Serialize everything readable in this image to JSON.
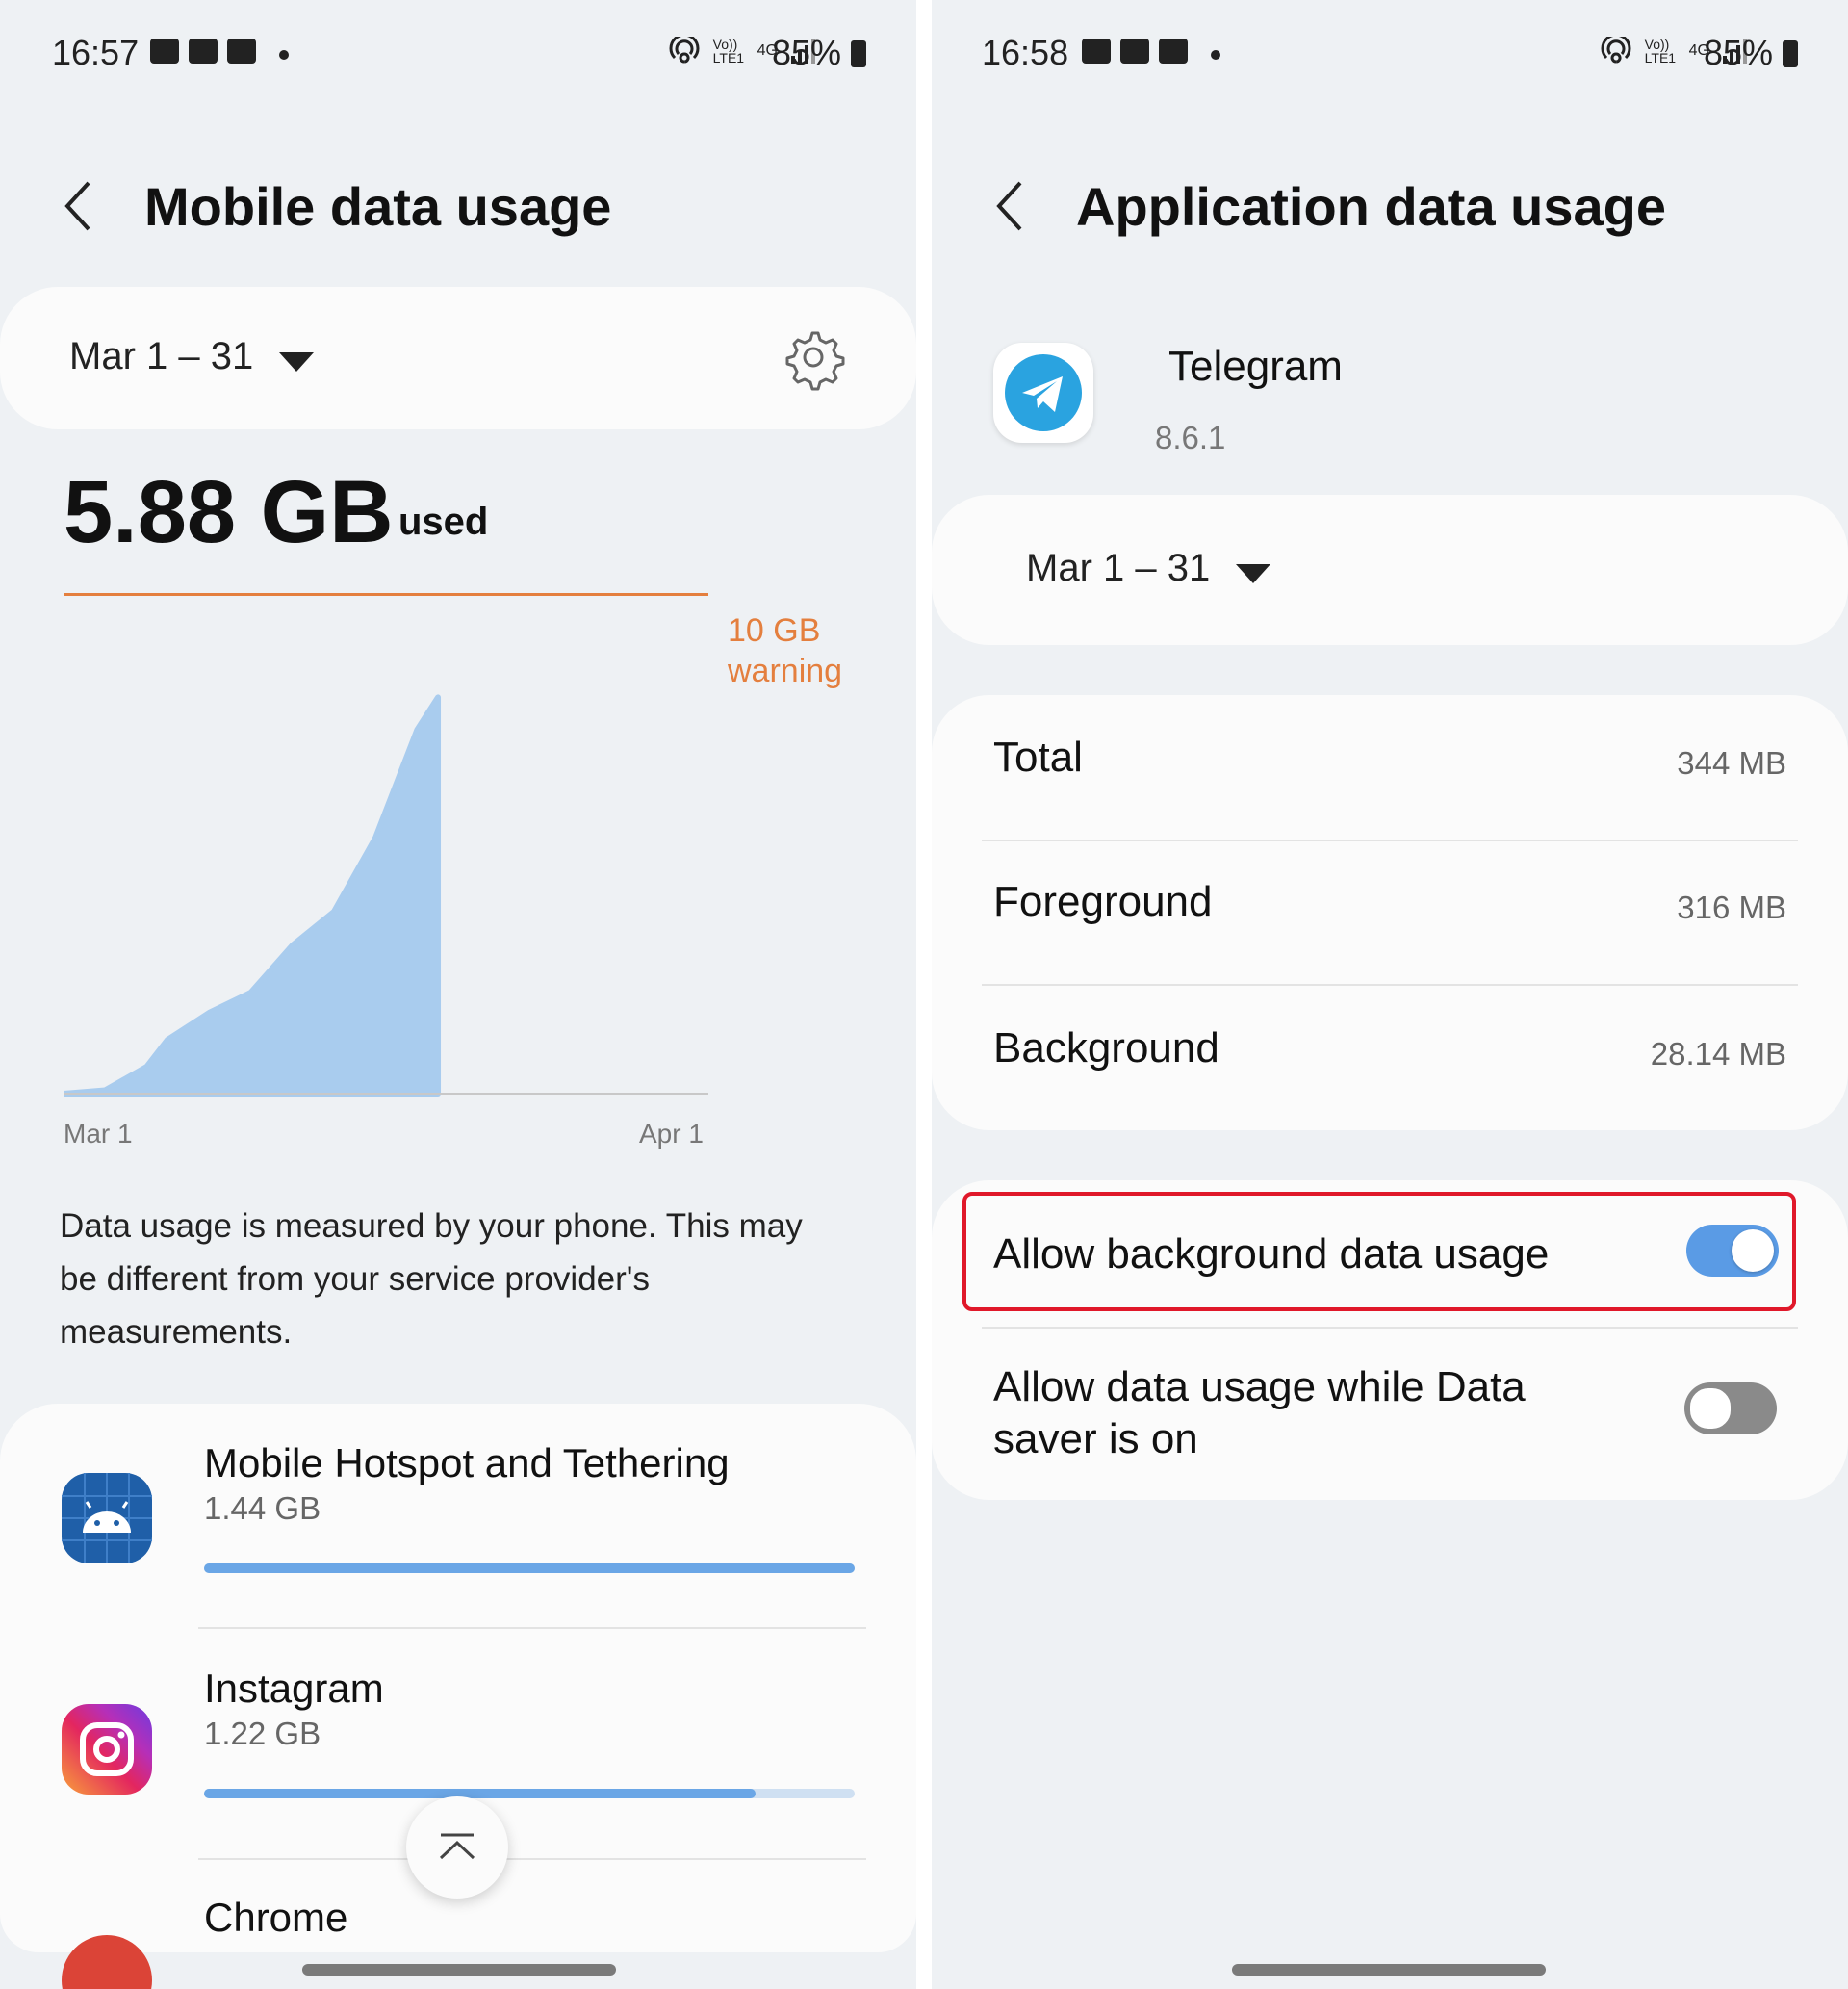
{
  "left": {
    "status": {
      "time": "16:57",
      "signal_labels": [
        "Vo)) LTE1",
        "4G"
      ],
      "battery": "85%"
    },
    "header": {
      "title": "Mobile data usage"
    },
    "period": {
      "label": "Mar 1 – 31"
    },
    "usage": {
      "amount": "5.88 GB",
      "unit_label": "used"
    },
    "warning": {
      "line1": "10 GB",
      "line2": "warning",
      "color": "#e47f3e"
    },
    "chart_data": {
      "type": "area",
      "x": [
        1,
        3,
        5,
        6,
        8,
        10,
        12,
        14,
        16,
        17,
        18,
        19
      ],
      "values": [
        0,
        0.05,
        0.4,
        0.8,
        1.2,
        1.5,
        2.2,
        2.7,
        3.8,
        4.6,
        5.4,
        5.88
      ],
      "unit": "GB",
      "ylim": [
        0,
        6.8
      ],
      "x_tick_labels": [
        "Mar 1",
        "Apr 1"
      ],
      "warning_level_gb": 10,
      "fill_color": "#a9ccee"
    },
    "note": "Data usage is measured by your phone. This may be different from your service provider's measurements.",
    "apps": [
      {
        "name": "Mobile Hotspot and Tethering",
        "size": "1.44 GB",
        "fraction": 1.0,
        "icon": "android-icon"
      },
      {
        "name": "Instagram",
        "size": "1.22 GB",
        "fraction": 0.847,
        "icon": "instagram-icon"
      },
      {
        "name": "Chrome",
        "size": "",
        "fraction": 0,
        "icon": "chrome-icon"
      }
    ]
  },
  "right": {
    "status": {
      "time": "16:58",
      "signal_labels": [
        "Vo)) LTE1",
        "4G"
      ],
      "battery": "85%"
    },
    "header": {
      "title": "Application data usage"
    },
    "app": {
      "name": "Telegram",
      "version": "8.6.1",
      "icon": "telegram-icon",
      "brand_color": "#2aa3e0"
    },
    "period": {
      "label": "Mar 1 – 31"
    },
    "stats": [
      {
        "label": "Total",
        "value": "344 MB"
      },
      {
        "label": "Foreground",
        "value": "316 MB"
      },
      {
        "label": "Background",
        "value": "28.14 MB"
      }
    ],
    "settings": [
      {
        "label": "Allow background data usage",
        "enabled": true,
        "highlighted": true
      },
      {
        "label": "Allow data usage while Data saver is on",
        "enabled": false,
        "highlighted": false
      }
    ],
    "accent_color": "#5a9be5",
    "highlight_color": "#e0182a"
  }
}
